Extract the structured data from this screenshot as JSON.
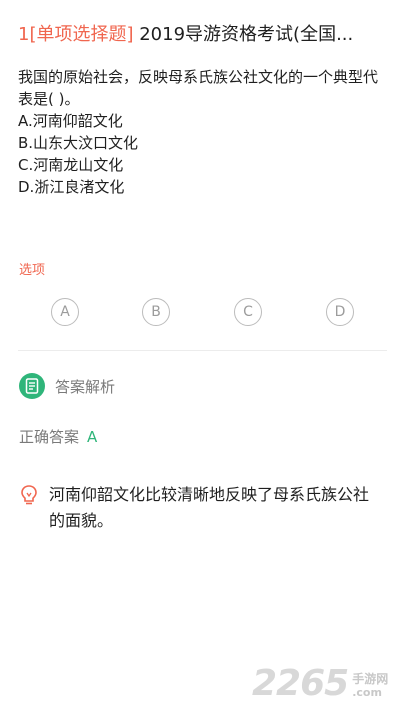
{
  "header": {
    "number": "1",
    "tag": "[单项选择题]",
    "title": "2019导游资格考试(全国..."
  },
  "question": {
    "stem": "我国的原始社会，反映母系氏族公社文化的一个典型代表是( )。",
    "options": [
      "A.河南仰韶文化",
      "B.山东大汶口文化",
      "C.河南龙山文化",
      "D.浙江良渚文化"
    ]
  },
  "choices": {
    "label": "选项",
    "items": [
      "A",
      "B",
      "C",
      "D"
    ]
  },
  "analysis": {
    "title": "答案解析",
    "answer_label": "正确答案",
    "answer_value": "A",
    "explanation": "河南仰韶文化比较清晰地反映了母系氏族公社的面貌。"
  },
  "watermark": {
    "number": "2265",
    "cn": "手游网",
    "domain": ".com"
  },
  "colors": {
    "accent_red": "#f0664f",
    "accent_green": "#2fb57a"
  }
}
